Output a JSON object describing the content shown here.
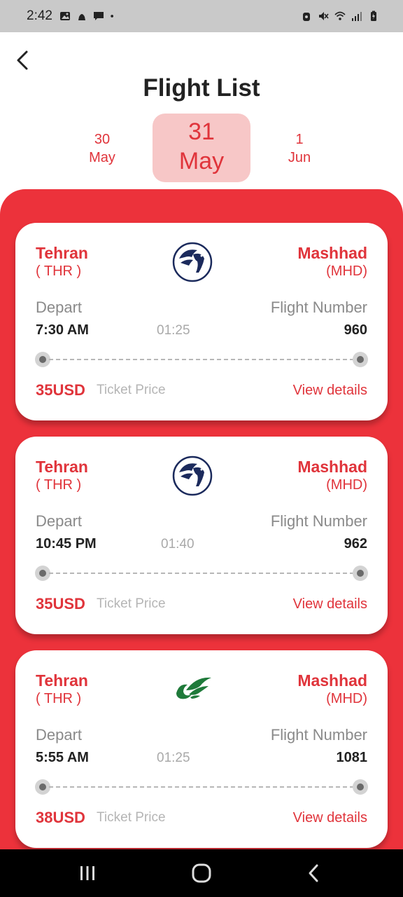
{
  "status_bar": {
    "time": "2:42",
    "icons_left": [
      "image-icon",
      "android-icon",
      "message-icon",
      "dot-icon"
    ],
    "icons_right": [
      "alarm-icon",
      "mute-icon",
      "wifi-icon",
      "signal-icon",
      "battery-icon"
    ]
  },
  "header": {
    "title": "Flight List",
    "back_icon": "chevron-left-icon"
  },
  "dates": {
    "prev": {
      "day": "30",
      "month": "May"
    },
    "active": {
      "day": "31",
      "month": "May"
    },
    "next": {
      "day": "1",
      "month": "Jun"
    }
  },
  "flights": [
    {
      "from_city": "Tehran",
      "from_code": "( THR )",
      "to_city": "Mashhad",
      "to_code": "(MHD)",
      "airline_logo": "homa-bird-logo",
      "depart_label": "Depart",
      "depart_time": "7:30 AM",
      "duration": "01:25",
      "flight_number_label": "Flight Number",
      "flight_number": "960",
      "price": "35USD",
      "price_label": "Ticket Price",
      "details_label": "View details"
    },
    {
      "from_city": "Tehran",
      "from_code": "( THR )",
      "to_city": "Mashhad",
      "to_code": "(MHD)",
      "airline_logo": "homa-bird-logo",
      "depart_label": "Depart",
      "depart_time": "10:45 PM",
      "duration": "01:40",
      "flight_number_label": "Flight Number",
      "flight_number": "962",
      "price": "35USD",
      "price_label": "Ticket Price",
      "details_label": "View details"
    },
    {
      "from_city": "Tehran",
      "from_code": "( THR )",
      "to_city": "Mashhad",
      "to_code": "(MHD)",
      "airline_logo": "green-leaf-bird-logo",
      "depart_label": "Depart",
      "depart_time": "5:55 AM",
      "duration": "01:25",
      "flight_number_label": "Flight Number",
      "flight_number": "1081",
      "price": "38USD",
      "price_label": "Ticket Price",
      "details_label": "View details"
    }
  ],
  "nav_bar": {
    "recents_icon": "recents-icon",
    "home_icon": "home-icon",
    "back_icon": "back-icon"
  },
  "colors": {
    "accent": "#e0343b",
    "panel": "#ec323b",
    "active_date_bg": "#f7c7c7",
    "homa_logo": "#1b2a5c",
    "green_logo": "#1f7a3a"
  }
}
